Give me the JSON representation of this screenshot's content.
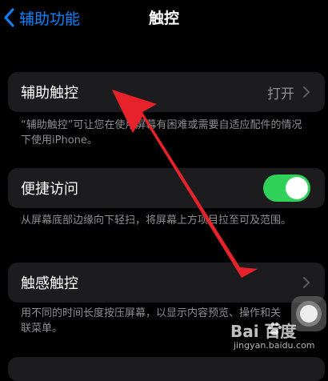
{
  "nav": {
    "back_label": "辅助功能",
    "title": "触控"
  },
  "assistive_touch": {
    "label": "辅助触控",
    "value": "打开",
    "footer": "“辅助触控”可让您在使用屏幕有困难或需要自适应配件的情况下使用iPhone。"
  },
  "reachability": {
    "label": "便捷访问",
    "toggle_on": true,
    "footer": "从屏幕底部边缘向下轻扫，将屏幕上方项目拉至可及范围。"
  },
  "haptic_touch": {
    "label": "触感触控",
    "footer": "用不同的时间长度按压屏幕，以显示内容预览、操作和关联菜单。"
  },
  "watermark": {
    "brand": "Bai  百度",
    "url": "jingyan.baidu.com"
  },
  "colors": {
    "accent": "#0a84ff",
    "toggle_on": "#30d158",
    "arrow": "#e8222a",
    "cell_bg": "#1c1c1e",
    "secondary_text": "#8e8e93"
  }
}
